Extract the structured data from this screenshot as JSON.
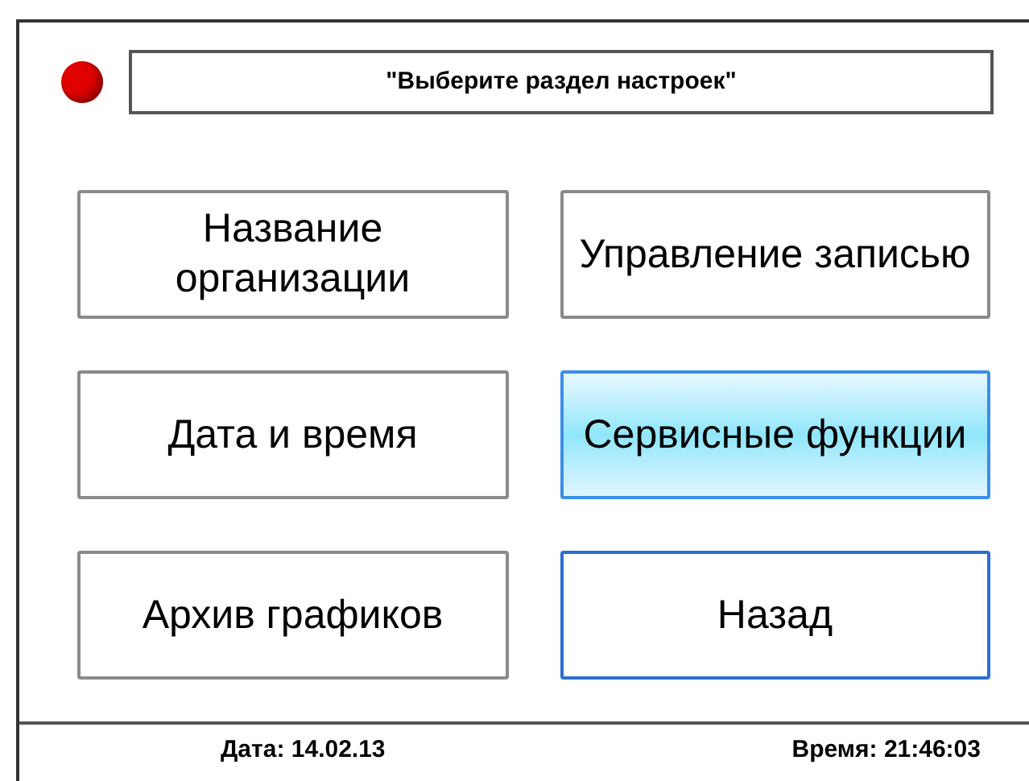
{
  "status_indicator": {
    "color": "#e00000"
  },
  "message": "\"Выберите раздел настроек\"",
  "buttons": [
    {
      "label": "Название организации",
      "highlighted": false,
      "focused": false
    },
    {
      "label": "Управление записью",
      "highlighted": false,
      "focused": false
    },
    {
      "label": "Дата и время",
      "highlighted": false,
      "focused": false
    },
    {
      "label": "Сервисные функции",
      "highlighted": true,
      "focused": false
    },
    {
      "label": "Архив графиков",
      "highlighted": false,
      "focused": false
    },
    {
      "label": "Назад",
      "highlighted": false,
      "focused": true
    }
  ],
  "status_bar": {
    "date": "Дата: 14.02.13",
    "time": "Время: 21:46:03"
  }
}
